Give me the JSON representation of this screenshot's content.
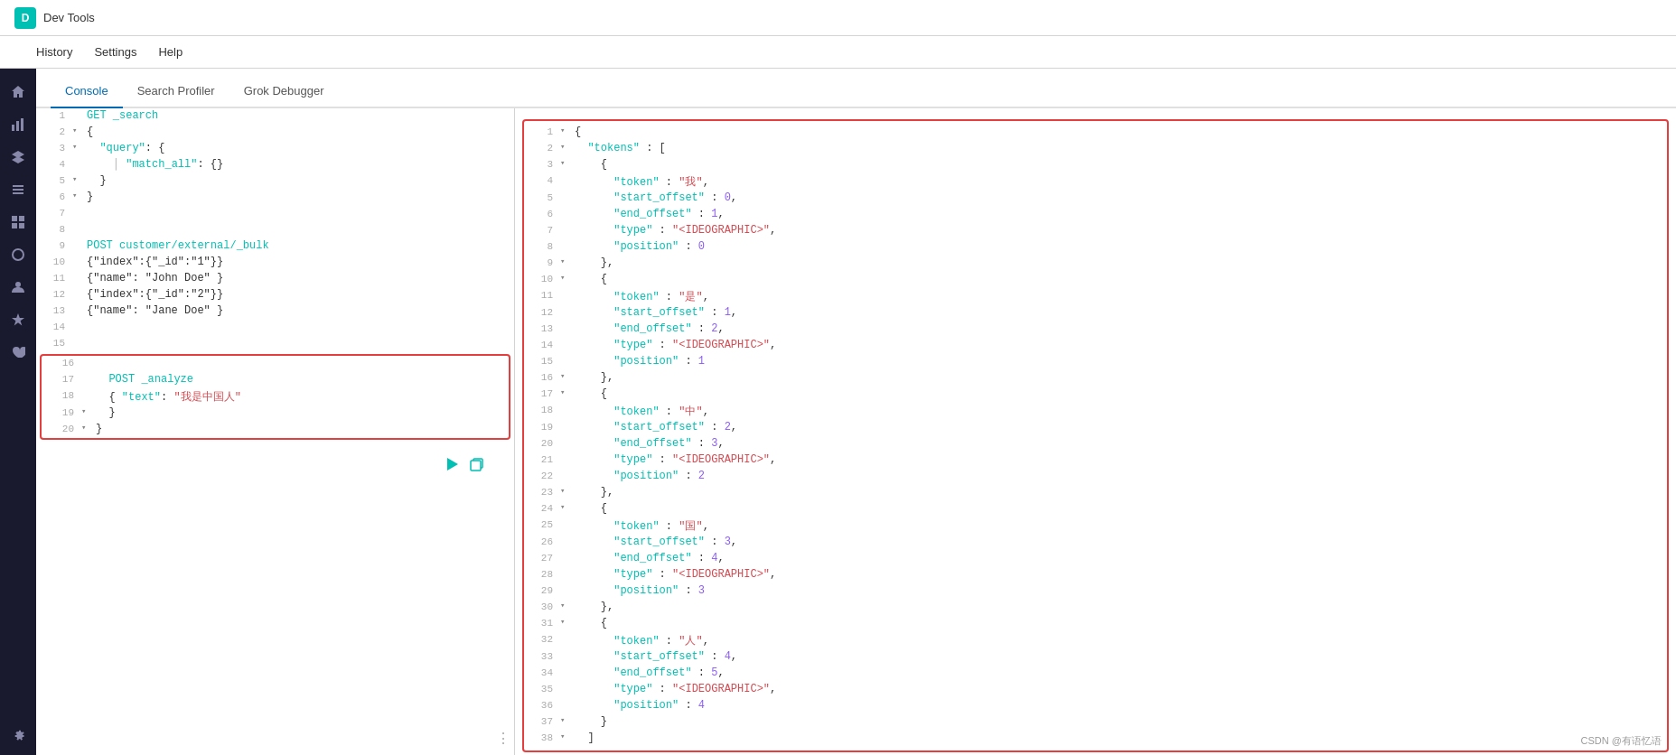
{
  "topbar": {
    "icon_label": "D",
    "title": "Dev Tools"
  },
  "menubar": {
    "items": [
      "History",
      "Settings",
      "Help"
    ]
  },
  "tabs": [
    {
      "label": "Console",
      "active": true
    },
    {
      "label": "Search Profiler",
      "active": false
    },
    {
      "label": "Grok Debugger",
      "active": false
    }
  ],
  "sidebar": {
    "icons": [
      "⊕",
      "↑",
      "≡",
      "☰",
      "⊞",
      "⊙",
      "◎",
      "⚙",
      "♡",
      "⚙"
    ]
  },
  "left_editor": {
    "lines": [
      {
        "num": 1,
        "arrow": "",
        "content": "GET _search",
        "type": "http"
      },
      {
        "num": 2,
        "arrow": "▾",
        "content": "{",
        "type": "brace"
      },
      {
        "num": 3,
        "arrow": "▾",
        "content": "  \"query\": {",
        "type": "key"
      },
      {
        "num": 4,
        "arrow": "",
        "content": "    \"match_all\": {}",
        "type": "key"
      },
      {
        "num": 5,
        "arrow": "▾",
        "content": "  }",
        "type": "brace"
      },
      {
        "num": 6,
        "arrow": "▾",
        "content": "}",
        "type": "brace"
      },
      {
        "num": 7,
        "arrow": "",
        "content": "",
        "type": "empty"
      },
      {
        "num": 8,
        "arrow": "",
        "content": "",
        "type": "empty"
      },
      {
        "num": 9,
        "arrow": "",
        "content": "POST customer/external/_bulk",
        "type": "http"
      },
      {
        "num": 10,
        "arrow": "",
        "content": "{\"index\":{\"_id\":\"1\"}}",
        "type": "brace"
      },
      {
        "num": 11,
        "arrow": "",
        "content": "{\"name\": \"John Doe\" }",
        "type": "brace"
      },
      {
        "num": 12,
        "arrow": "",
        "content": "{\"index\":{\"_id\":\"2\"}}",
        "type": "brace"
      },
      {
        "num": 13,
        "arrow": "",
        "content": "{\"name\": \"Jane Doe\" }",
        "type": "brace"
      },
      {
        "num": 14,
        "arrow": "",
        "content": "",
        "type": "empty"
      },
      {
        "num": 15,
        "arrow": "",
        "content": "",
        "type": "empty"
      }
    ],
    "selected_block": {
      "lines": [
        {
          "num": 16,
          "arrow": "",
          "content": "",
          "type": "empty"
        },
        {
          "num": 17,
          "arrow": "",
          "content": "  POST _analyze",
          "type": "http"
        },
        {
          "num": 18,
          "arrow": "",
          "content": "  { \"text\": \"我是中国人\"",
          "type": "brace"
        },
        {
          "num": 19,
          "arrow": "▾",
          "content": "  }",
          "type": "brace"
        },
        {
          "num": 20,
          "arrow": "▾",
          "content": "}",
          "type": "brace"
        }
      ]
    }
  },
  "right_output": {
    "lines": [
      {
        "num": 1,
        "arrow": "▾",
        "content": "{"
      },
      {
        "num": 2,
        "arrow": "▾",
        "content": "  \"tokens\" : ["
      },
      {
        "num": 3,
        "arrow": "▾",
        "content": "    {"
      },
      {
        "num": 4,
        "arrow": "",
        "content": "      \"token\" : \"我\","
      },
      {
        "num": 5,
        "arrow": "",
        "content": "      \"start_offset\" : 0,"
      },
      {
        "num": 6,
        "arrow": "",
        "content": "      \"end_offset\" : 1,"
      },
      {
        "num": 7,
        "arrow": "",
        "content": "      \"type\" : \"<IDEOGRAPHIC>\","
      },
      {
        "num": 8,
        "arrow": "",
        "content": "      \"position\" : 0"
      },
      {
        "num": 9,
        "arrow": "▾",
        "content": "    },"
      },
      {
        "num": 10,
        "arrow": "▾",
        "content": "    {"
      },
      {
        "num": 11,
        "arrow": "",
        "content": "      \"token\" : \"是\","
      },
      {
        "num": 12,
        "arrow": "",
        "content": "      \"start_offset\" : 1,"
      },
      {
        "num": 13,
        "arrow": "",
        "content": "      \"end_offset\" : 2,"
      },
      {
        "num": 14,
        "arrow": "",
        "content": "      \"type\" : \"<IDEOGRAPHIC>\","
      },
      {
        "num": 15,
        "arrow": "",
        "content": "      \"position\" : 1"
      },
      {
        "num": 16,
        "arrow": "▾",
        "content": "    },"
      },
      {
        "num": 17,
        "arrow": "▾",
        "content": "    {"
      },
      {
        "num": 18,
        "arrow": "",
        "content": "      \"token\" : \"中\","
      },
      {
        "num": 19,
        "arrow": "",
        "content": "      \"start_offset\" : 2,"
      },
      {
        "num": 20,
        "arrow": "",
        "content": "      \"end_offset\" : 3,"
      },
      {
        "num": 21,
        "arrow": "",
        "content": "      \"type\" : \"<IDEOGRAPHIC>\","
      },
      {
        "num": 22,
        "arrow": "",
        "content": "      \"position\" : 2"
      },
      {
        "num": 23,
        "arrow": "▾",
        "content": "    },"
      },
      {
        "num": 24,
        "arrow": "▾",
        "content": "    {"
      },
      {
        "num": 25,
        "arrow": "",
        "content": "      \"token\" : \"国\","
      },
      {
        "num": 26,
        "arrow": "",
        "content": "      \"start_offset\" : 3,"
      },
      {
        "num": 27,
        "arrow": "",
        "content": "      \"end_offset\" : 4,"
      },
      {
        "num": 28,
        "arrow": "",
        "content": "      \"type\" : \"<IDEOGRAPHIC>\","
      },
      {
        "num": 29,
        "arrow": "",
        "content": "      \"position\" : 3"
      },
      {
        "num": 30,
        "arrow": "▾",
        "content": "    },"
      },
      {
        "num": 31,
        "arrow": "▾",
        "content": "    {"
      },
      {
        "num": 32,
        "arrow": "",
        "content": "      \"token\" : \"人\","
      },
      {
        "num": 33,
        "arrow": "",
        "content": "      \"start_offset\" : 4,"
      },
      {
        "num": 34,
        "arrow": "",
        "content": "      \"end_offset\" : 5,"
      },
      {
        "num": 35,
        "arrow": "",
        "content": "      \"type\" : \"<IDEOGRAPHIC>\","
      },
      {
        "num": 36,
        "arrow": "",
        "content": "      \"position\" : 4"
      },
      {
        "num": 37,
        "arrow": "▾",
        "content": "    }"
      },
      {
        "num": 38,
        "arrow": "▾",
        "content": "  ]"
      }
    ]
  },
  "watermark": "CSDN @有语忆语"
}
